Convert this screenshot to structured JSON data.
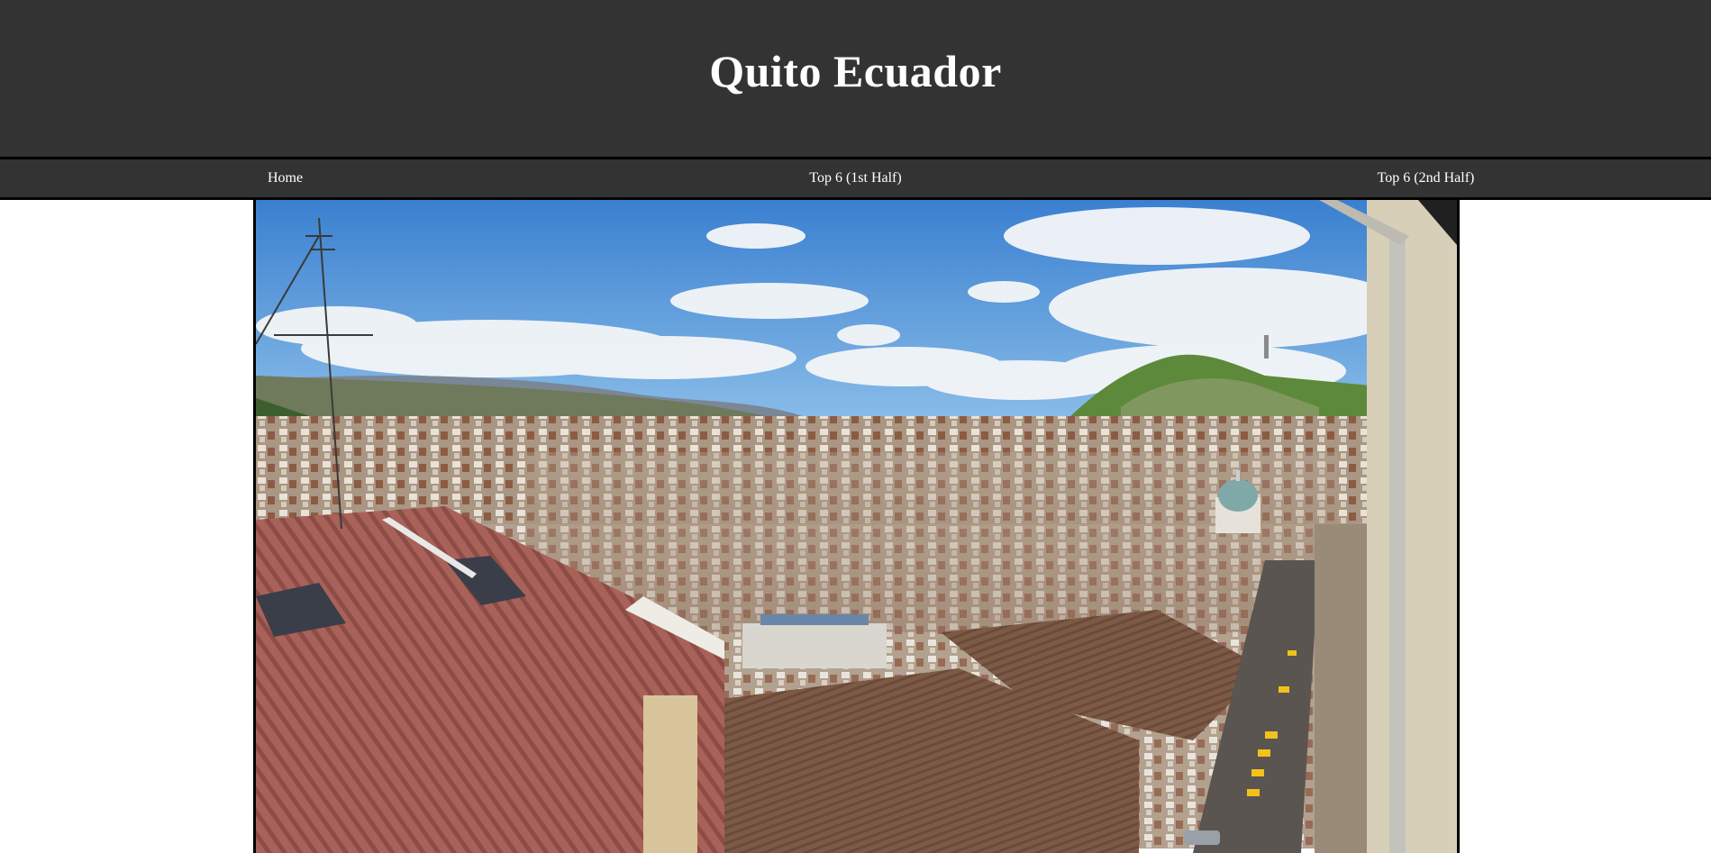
{
  "page": {
    "title": "Quito Ecuador"
  },
  "nav": {
    "items": [
      {
        "label": "Home"
      },
      {
        "label": "Top 6 (1st Half)"
      },
      {
        "label": "Top 6 (2nd Half)"
      }
    ]
  },
  "hero_image": {
    "subject": "Panoramic view over the rooftops of Quito's historic center toward El Panecillo hill",
    "colors": {
      "sky": "#4a8fd6",
      "roof": "#a8625a",
      "hill": "#5d8a3a"
    }
  },
  "theme": {
    "header_bg": "#333333",
    "text": "#ffffff",
    "border": "#000000"
  }
}
